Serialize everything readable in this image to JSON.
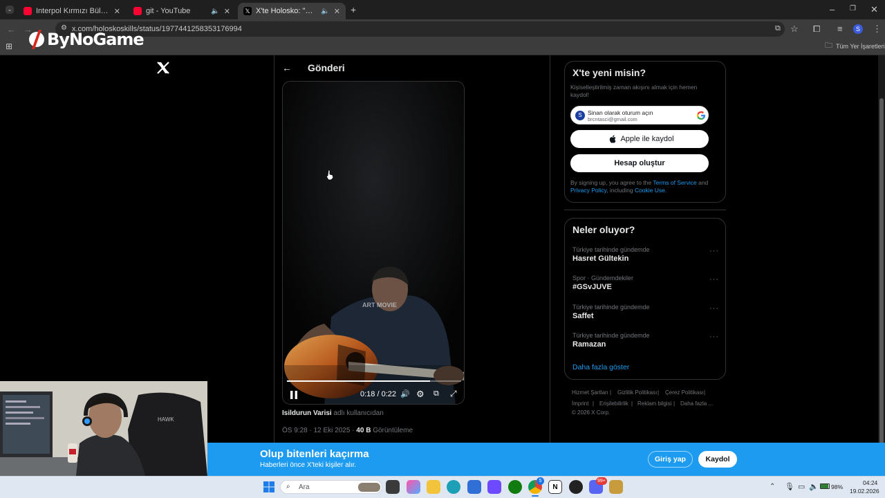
{
  "browser": {
    "tabs": [
      {
        "title": "Interpol Kırmızı Bültenle Aranan"
      },
      {
        "title": "git - YouTube"
      },
      {
        "title": "X'te Holosko: \"gelmeyeceğim..."
      }
    ],
    "url": "x.com/holoskoskills/status/1977441258353176994",
    "bookmarks_label": "Tüm Yer İşaretleri",
    "watermark": "ByNoGame",
    "profile_initial": "S"
  },
  "post": {
    "header": "Gönderi",
    "video_time": "0:18 / 0:22",
    "video_watermark": "ART MOVIE",
    "author_name": "Isildurun Varisi",
    "author_suffix": "adlı kullanıcıdan",
    "meta_time": "ÖS 9:28 · 12 Eki 2025 ·",
    "views_count": "40 B",
    "views_label": "Görüntüleme",
    "progress": 0.82
  },
  "signup": {
    "title": "X'te yeni misin?",
    "subtitle": "Kişiselleştirilmiş zaman akışını almak için hemen kaydol!",
    "google_name": "Sinan olarak oturum açın",
    "google_email": "brcntasci@gmail.com",
    "google_avatar": "S",
    "apple_label": "Apple ile kaydol",
    "create_label": "Hesap oluştur",
    "legal_prefix": "By signing up, you agree to the",
    "terms": "Terms of Service",
    "legal_and": "and",
    "privacy": "Privacy Policy",
    "legal_including": ", including",
    "cookie": "Cookie Use."
  },
  "trends": {
    "title": "Neler oluyor?",
    "items": [
      {
        "meta": "Türkiye tarihinde gündemde",
        "name": "Hasret Gültekin"
      },
      {
        "meta": "Spor · Gündemdekiler",
        "name": "#GSvJUVE"
      },
      {
        "meta": "Türkiye tarihinde gündemde",
        "name": "Saffet"
      },
      {
        "meta": "Türkiye tarihinde gündemde",
        "name": "Ramazan"
      }
    ],
    "more": "Daha fazla göster"
  },
  "footer": {
    "l1": [
      "Hizmet Şartları",
      "Gizlilik Politikası",
      "Çerez Politikası"
    ],
    "l2": [
      "İmprint",
      "Erişilebilirlik",
      "Reklam bilgisi",
      "Daha fazla ..."
    ],
    "copyright": "© 2026 X Corp."
  },
  "banner": {
    "title": "Olup bitenleri kaçırma",
    "subtitle": "Haberleri önce X'teki kişiler alır.",
    "login": "Giriş yap",
    "signup": "Kaydol"
  },
  "taskbar": {
    "search": "Ara",
    "battery": "98%",
    "time": "04:24",
    "date": "19.02.2026",
    "chrome_badge": "5",
    "discord_badge": "99+"
  }
}
